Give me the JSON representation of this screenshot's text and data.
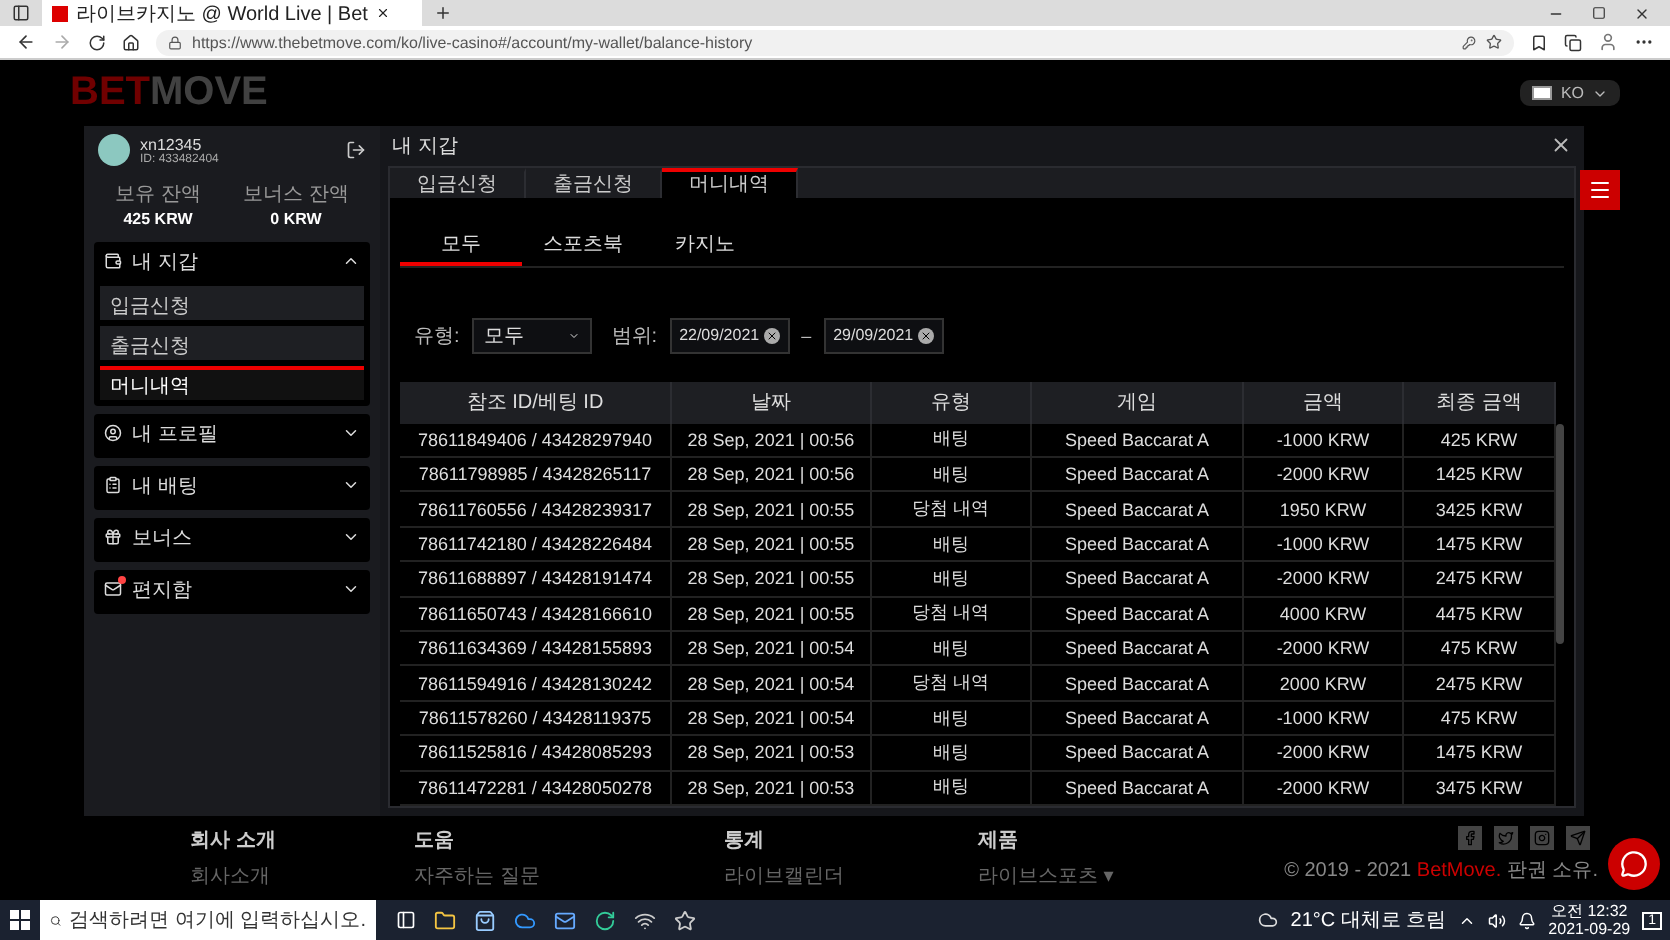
{
  "browser": {
    "tab_title": "라이브카지노 @ World Live | Bet",
    "url": "https://www.thebetmove.com/ko/live-casino#/account/my-wallet/balance-history"
  },
  "site": {
    "logo_left": "BET",
    "logo_right": "MOVE",
    "language": "KO"
  },
  "sidebar": {
    "username": "xn12345",
    "user_id": "ID: 433482404",
    "balances": [
      {
        "label": "보유 잔액",
        "value": "425 KRW"
      },
      {
        "label": "보너스 잔액",
        "value": "0 KRW"
      }
    ],
    "menu": [
      {
        "label": "내 지갑",
        "expanded": true,
        "badge": false,
        "children": [
          {
            "label": "입금신청",
            "selected": false
          },
          {
            "label": "출금신청",
            "selected": false
          },
          {
            "label": "머니내역",
            "selected": true
          }
        ]
      },
      {
        "label": "내 프로필",
        "expanded": false,
        "badge": false
      },
      {
        "label": "내 배팅",
        "expanded": false,
        "badge": false
      },
      {
        "label": "보너스",
        "expanded": false,
        "badge": false
      },
      {
        "label": "편지함",
        "expanded": false,
        "badge": true
      }
    ]
  },
  "modal": {
    "title": "내 지갑",
    "tabs": [
      {
        "label": "입금신청",
        "selected": false
      },
      {
        "label": "출금신청",
        "selected": false
      },
      {
        "label": "머니내역",
        "selected": true
      }
    ],
    "subtabs": [
      {
        "label": "모두",
        "selected": true
      },
      {
        "label": "스포츠북",
        "selected": false
      },
      {
        "label": "카지노",
        "selected": false
      }
    ],
    "filter": {
      "type_label": "유형:",
      "type_value": "모두",
      "range_label": "범위:",
      "date_from": "22/09/2021",
      "range_separator": "–",
      "date_to": "29/09/2021"
    },
    "table": {
      "columns": [
        "참조 ID/베팅 ID",
        "날짜",
        "유형",
        "게임",
        "금액",
        "최종 금액"
      ],
      "rows": [
        [
          "78611849406 / 43428297940",
          "28 Sep, 2021 | 00:56",
          "배팅",
          "Speed Baccarat A",
          "-1000 KRW",
          "425 KRW"
        ],
        [
          "78611798985 / 43428265117",
          "28 Sep, 2021 | 00:56",
          "배팅",
          "Speed Baccarat A",
          "-2000 KRW",
          "1425 KRW"
        ],
        [
          "78611760556 / 43428239317",
          "28 Sep, 2021 | 00:55",
          "당첨 내역",
          "Speed Baccarat A",
          "1950 KRW",
          "3425 KRW"
        ],
        [
          "78611742180 / 43428226484",
          "28 Sep, 2021 | 00:55",
          "배팅",
          "Speed Baccarat A",
          "-1000 KRW",
          "1475 KRW"
        ],
        [
          "78611688897 / 43428191474",
          "28 Sep, 2021 | 00:55",
          "배팅",
          "Speed Baccarat A",
          "-2000 KRW",
          "2475 KRW"
        ],
        [
          "78611650743 / 43428166610",
          "28 Sep, 2021 | 00:55",
          "당첨 내역",
          "Speed Baccarat A",
          "4000 KRW",
          "4475 KRW"
        ],
        [
          "78611634369 / 43428155893",
          "28 Sep, 2021 | 00:54",
          "배팅",
          "Speed Baccarat A",
          "-2000 KRW",
          "475 KRW"
        ],
        [
          "78611594916 / 43428130242",
          "28 Sep, 2021 | 00:54",
          "당첨 내역",
          "Speed Baccarat A",
          "2000 KRW",
          "2475 KRW"
        ],
        [
          "78611578260 / 43428119375",
          "28 Sep, 2021 | 00:54",
          "배팅",
          "Speed Baccarat A",
          "-1000 KRW",
          "475 KRW"
        ],
        [
          "78611525816 / 43428085293",
          "28 Sep, 2021 | 00:53",
          "배팅",
          "Speed Baccarat A",
          "-2000 KRW",
          "1475 KRW"
        ],
        [
          "78611472281 / 43428050278",
          "28 Sep, 2021 | 00:53",
          "배팅",
          "Speed Baccarat A",
          "-2000 KRW",
          "3475 KRW"
        ]
      ]
    }
  },
  "footer": {
    "columns": [
      {
        "heading": "회사 소개",
        "link": "회사소개"
      },
      {
        "heading": "도움",
        "link": "자주하는 질문"
      },
      {
        "heading": "통계",
        "link": "라이브캘린더"
      },
      {
        "heading": "제품",
        "link": "라이브스포츠 ▾"
      }
    ],
    "copyright_prefix": "© 2019 - 2021",
    "copyright_brand": "BetMove.",
    "copyright_suffix": "판권 소유."
  },
  "taskbar": {
    "search_placeholder": "검색하려면 여기에 입력하십시오.",
    "weather": "21°C 대체로 흐림",
    "time": "오전 12:32",
    "date": "2021-09-29",
    "notification_count": "1"
  }
}
